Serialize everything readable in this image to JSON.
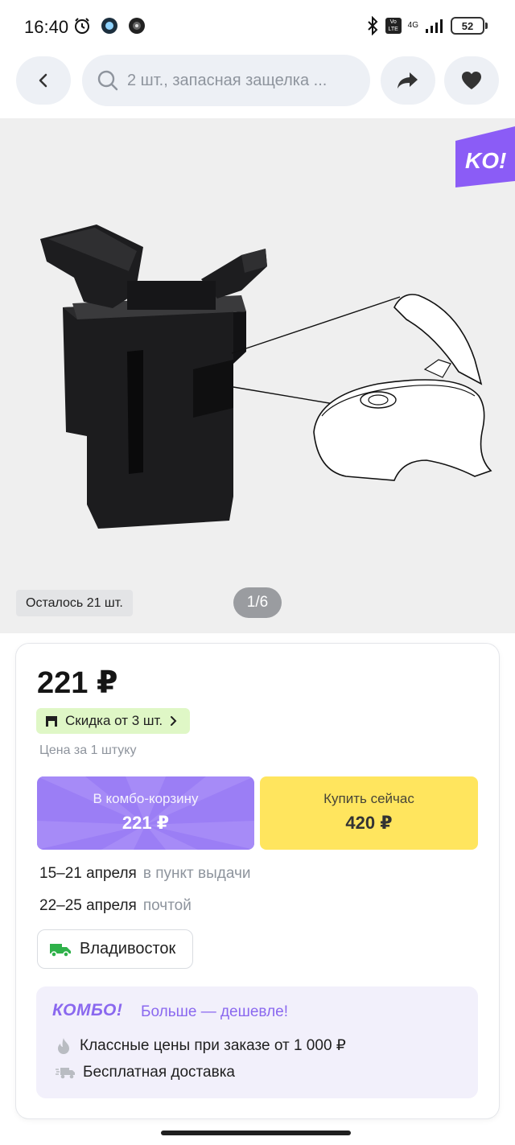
{
  "status_bar": {
    "time": "16:40",
    "battery": "52",
    "network": "4G",
    "volte": "Vo LTE",
    "icons": [
      "alarm-icon",
      "app-notification-icon",
      "app-notification-icon-2",
      "bluetooth-icon",
      "signal-icon",
      "battery-icon"
    ]
  },
  "toolbar": {
    "search_text": "2 шт., запасная защелка ...",
    "icons": [
      "back-icon",
      "search-icon",
      "share-icon",
      "heart-icon"
    ]
  },
  "gallery": {
    "badge_text": "KO!",
    "stock_left": "Осталось 21 шт.",
    "pager": "1/6"
  },
  "product": {
    "price": "221 ₽",
    "discount_label": "Скидка от 3 шт.",
    "unit_note": "Цена за 1 штуку",
    "combo_button": {
      "label": "В комбо-корзину",
      "price": "221 ₽"
    },
    "buy_button": {
      "label": "Купить сейчас",
      "price": "420 ₽"
    }
  },
  "delivery": [
    {
      "dates": "15–21 апреля",
      "method": "в пункт выдачи"
    },
    {
      "dates": "22–25 апреля",
      "method": "почтой"
    }
  ],
  "city": "Владивосток",
  "combo_promo": {
    "logo": "КОМБО!",
    "tagline": "Больше — дешевле!",
    "benefits": [
      "Классные цены при заказе от 1 000 ₽",
      "Бесплатная доставка"
    ]
  },
  "colors": {
    "accent_purple": "#9b7ef5",
    "buy_yellow": "#ffe55e",
    "discount_green_bg": "#dff7c6",
    "truck_green": "#2fb14a",
    "badge_purple": "#8b5cf6"
  }
}
